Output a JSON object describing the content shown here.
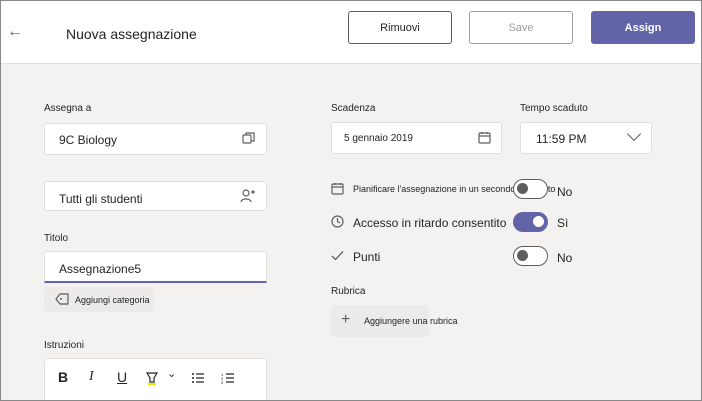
{
  "header": {
    "title": "Nuova assegnazione",
    "remove_label": "Rimuovi",
    "save_label": "Save",
    "assign_label": "Assign",
    "back_icon": "←"
  },
  "assign_to": {
    "label": "Assegna a",
    "class_value": "9C Biology",
    "students_value": "Tutti gli studenti"
  },
  "title_field": {
    "label": "Titolo",
    "value": "Assegnazione5",
    "category_button": "Aggiungi categoria"
  },
  "instructions": {
    "label": "Istruzioni",
    "toolbar": {
      "bold": "B",
      "italic": "I",
      "underline": "U",
      "highlight_chevron": "⌄",
      "bullets": "☰",
      "numbered": "☰"
    }
  },
  "due": {
    "label": "Scadenza",
    "date_value": "5 gennaio 2019",
    "time_label": "Tempo scaduto",
    "time_value": "11:59 PM"
  },
  "options": [
    {
      "label": "Pianificare l'assegnazione in un secondo momento",
      "state": "No",
      "enabled": false
    },
    {
      "label": "Accesso in ritardo consentito",
      "state": "Sì",
      "enabled": true
    },
    {
      "label": "Punti",
      "state": "No",
      "enabled": false
    }
  ],
  "rubric": {
    "label": "Rubrica",
    "add_button": "Aggiungere una rubrica"
  },
  "colors": {
    "accent": "#6264a7",
    "background": "#f3f2f1",
    "border": "#e1dfdd"
  }
}
